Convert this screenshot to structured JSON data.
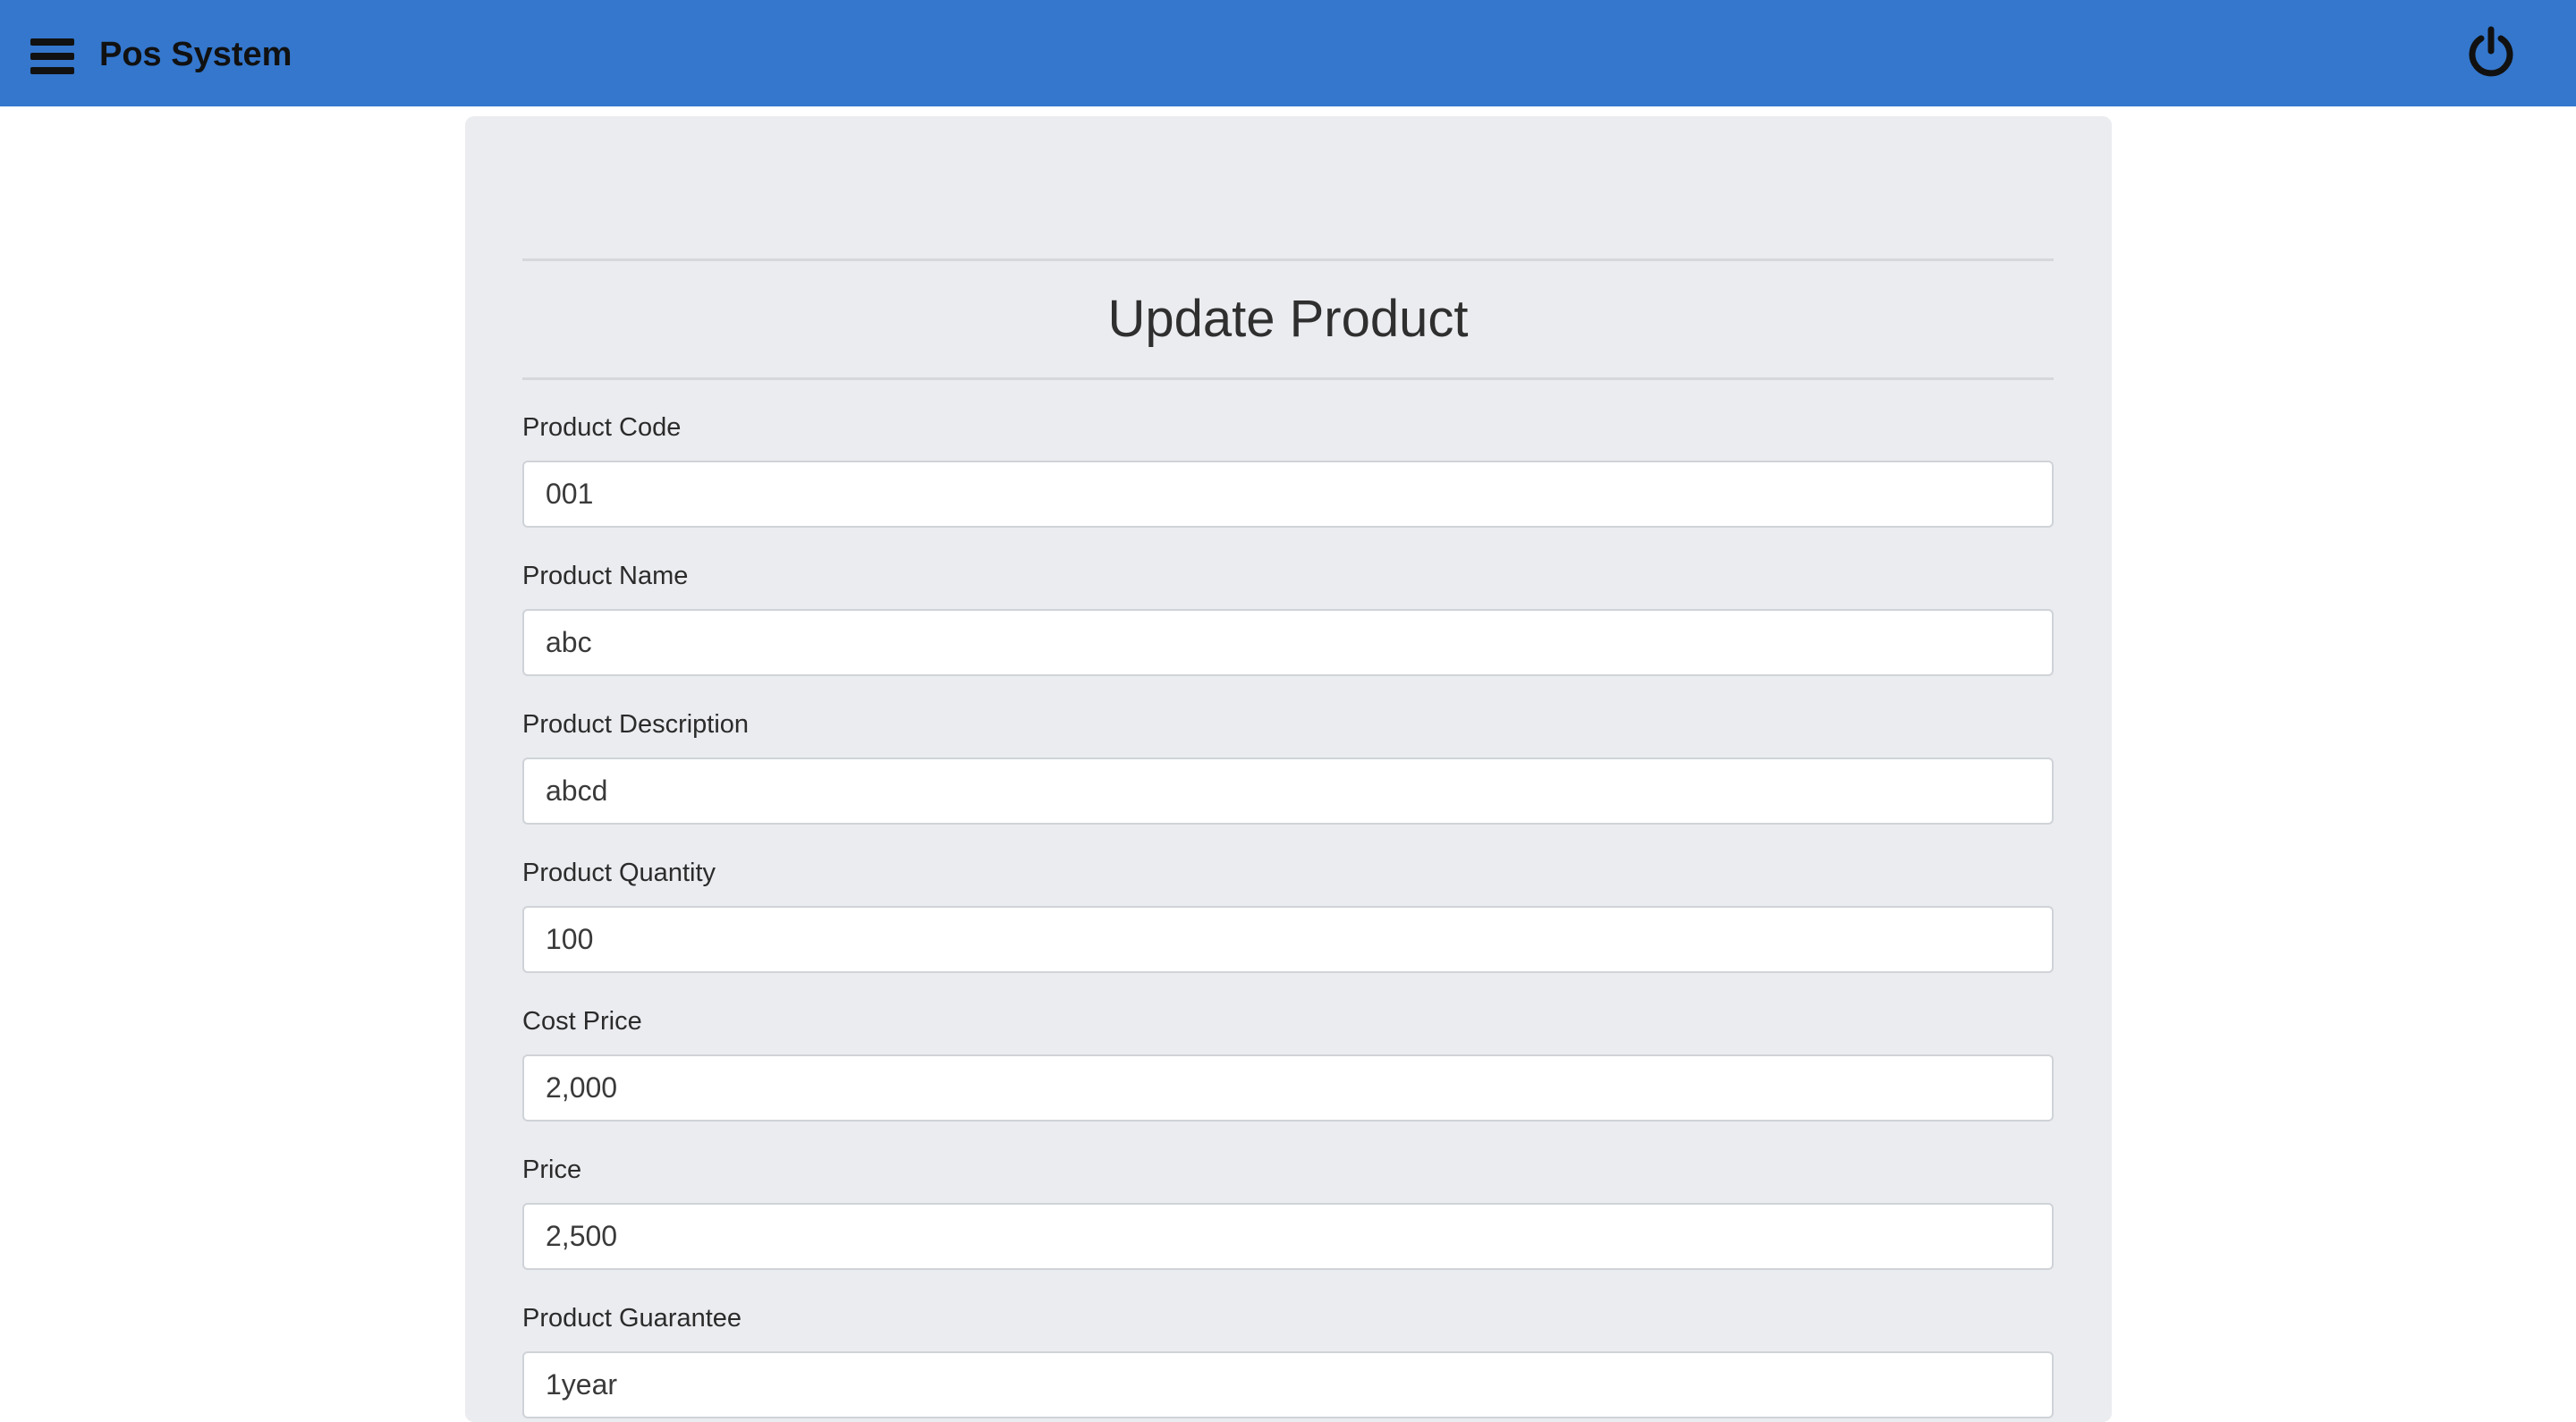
{
  "app": {
    "title": "Pos System"
  },
  "header": {
    "menu_icon": "hamburger-menu-icon",
    "power_icon": "power-icon",
    "bar_color": "#3477cd"
  },
  "form": {
    "title": "Update Product",
    "fields": [
      {
        "label": "Product Code",
        "value": "001"
      },
      {
        "label": "Product Name",
        "value": "abc"
      },
      {
        "label": "Product Description",
        "value": "abcd"
      },
      {
        "label": "Product Quantity",
        "value": "100"
      },
      {
        "label": "Cost Price",
        "value": "2,000"
      },
      {
        "label": "Price",
        "value": "2,500"
      },
      {
        "label": "Product Guarantee",
        "value": "1year"
      }
    ]
  }
}
